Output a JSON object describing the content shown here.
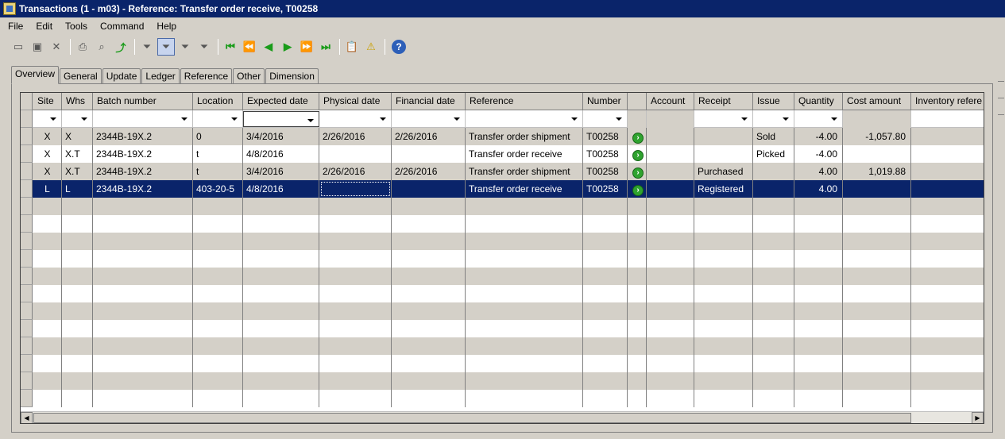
{
  "window": {
    "title": "Transactions (1 - m03) - Reference: Transfer order receive, T00258"
  },
  "menu": [
    "File",
    "Edit",
    "Tools",
    "Command",
    "Help"
  ],
  "toolbar": {
    "icons": [
      "new-icon",
      "save-icon",
      "delete-icon",
      "print-icon",
      "print-preview-icon",
      "export-excel-icon",
      "filter-by-selection-icon",
      "filter-by-grid-icon",
      "advanced-filter-icon",
      "remove-filter-icon",
      "first-record-icon",
      "previous-page-icon",
      "previous-record-icon",
      "next-record-icon",
      "next-page-icon",
      "last-record-icon",
      "attachment-icon",
      "alert-icon",
      "help-icon"
    ]
  },
  "tabs": [
    "Overview",
    "General",
    "Update",
    "Ledger",
    "Reference",
    "Other",
    "Dimension"
  ],
  "grid": {
    "columns": [
      "Site",
      "Whs",
      "Batch number",
      "Location",
      "Expected date",
      "Physical date",
      "Financial date",
      "Reference",
      "Number",
      "",
      "Account",
      "Receipt",
      "Issue",
      "Quantity",
      "Cost amount",
      "Inventory refere"
    ],
    "rows": [
      [
        "X",
        "X",
        "2344B-19X.2",
        "0",
        "3/4/2016",
        "2/26/2016",
        "2/26/2016",
        "Transfer order shipment",
        "T00258",
        "",
        "",
        "",
        "Sold",
        "-4.00",
        "-1,057.80",
        ""
      ],
      [
        "X",
        "X.T",
        "2344B-19X.2",
        "t",
        "4/8/2016",
        "",
        "",
        "Transfer order receive",
        "T00258",
        "",
        "",
        "",
        "Picked",
        "-4.00",
        "",
        ""
      ],
      [
        "X",
        "X.T",
        "2344B-19X.2",
        "t",
        "3/4/2016",
        "2/26/2016",
        "2/26/2016",
        "Transfer order shipment",
        "T00258",
        "",
        "",
        "Purchased",
        "",
        "4.00",
        "1,019.88",
        ""
      ],
      [
        "L",
        "L",
        "2344B-19X.2",
        "403-20-5",
        "4/8/2016",
        "",
        "",
        "Transfer order receive",
        "T00258",
        "",
        "",
        "Registered",
        "",
        "4.00",
        "",
        ""
      ]
    ]
  }
}
